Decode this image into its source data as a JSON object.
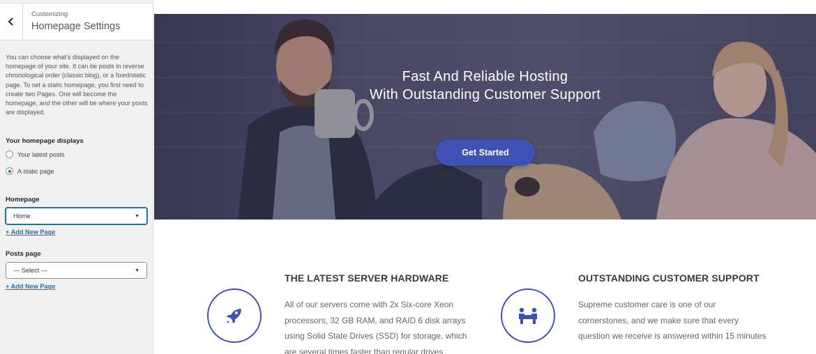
{
  "customizer": {
    "subtitle": "Customizing",
    "title": "Homepage Settings",
    "description": "You can choose what’s displayed on the homepage of your site. It can be posts in reverse chronological order (classic blog), or a fixed/static page. To set a static homepage, you first need to create two Pages. One will become the homepage, and the other will be where your posts are displayed.",
    "displays_label": "Your homepage displays",
    "option_latest": "Your latest posts",
    "option_static": "A static page",
    "homepage_label": "Homepage",
    "homepage_value": "Home",
    "add_new_page": "+ Add New Page",
    "posts_label": "Posts page",
    "posts_value": "— Select —",
    "add_new_page_2": "+ Add New Page"
  },
  "hero": {
    "title_line1": "Fast And Reliable Hosting",
    "title_line2": "With Outstanding Customer Support",
    "cta": "Get Started"
  },
  "features": [
    {
      "title": "THE LATEST SERVER HARDWARE",
      "text": "All of our servers come with 2x Six-core Xeon processors, 32 GB RAM, and RAID 6 disk arrays using Solid State Drives (SSD) for storage, which are several times faster than regular drives",
      "icon": "rocket-icon"
    },
    {
      "title": "OUTSTANDING CUSTOMER SUPPORT",
      "text": "Supreme customer care is one of our cornerstones, and we make sure that every question we receive is answered within 15 minutes",
      "icon": "team-icon"
    }
  ],
  "colors": {
    "accent": "#3f51b5",
    "link": "#2271b1"
  }
}
